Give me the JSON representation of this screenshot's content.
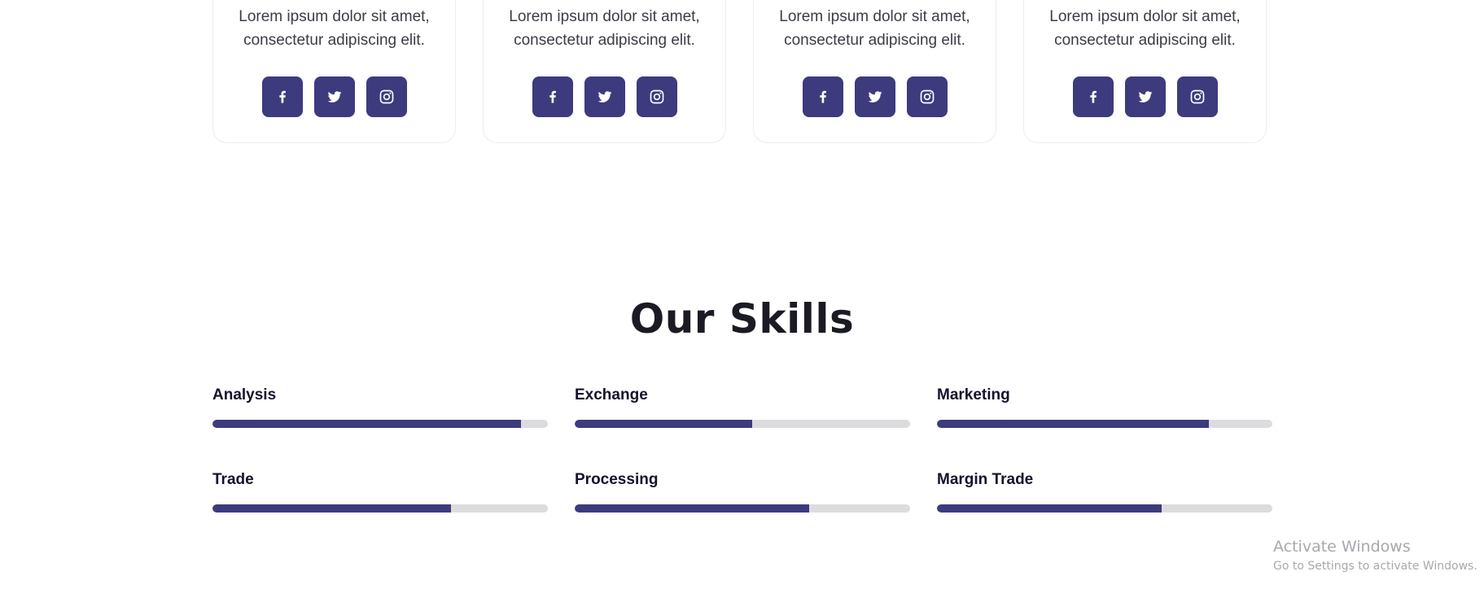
{
  "team": {
    "cards": [
      {
        "text": "Lorem ipsum dolor sit amet, consectetur adipiscing elit."
      },
      {
        "text": "Lorem ipsum dolor sit amet, consectetur adipiscing elit."
      },
      {
        "text": "Lorem ipsum dolor sit amet, consectetur adipiscing elit."
      },
      {
        "text": "Lorem ipsum dolor sit amet, consectetur adipiscing elit."
      }
    ],
    "social_icons": [
      "facebook-icon",
      "twitter-icon",
      "instagram-icon"
    ]
  },
  "skills": {
    "title": "Our Skills",
    "items": [
      {
        "label": "Analysis",
        "percent": 92
      },
      {
        "label": "Exchange",
        "percent": 53
      },
      {
        "label": "Marketing",
        "percent": 81
      },
      {
        "label": "Trade",
        "percent": 71
      },
      {
        "label": "Processing",
        "percent": 70
      },
      {
        "label": "Margin Trade",
        "percent": 67
      }
    ]
  },
  "colors": {
    "accent": "#3d3a7e",
    "track": "#dcdcde",
    "heading": "#1b1b24"
  },
  "watermark": {
    "title": "Activate Windows",
    "subtitle": "Go to Settings to activate Windows."
  }
}
